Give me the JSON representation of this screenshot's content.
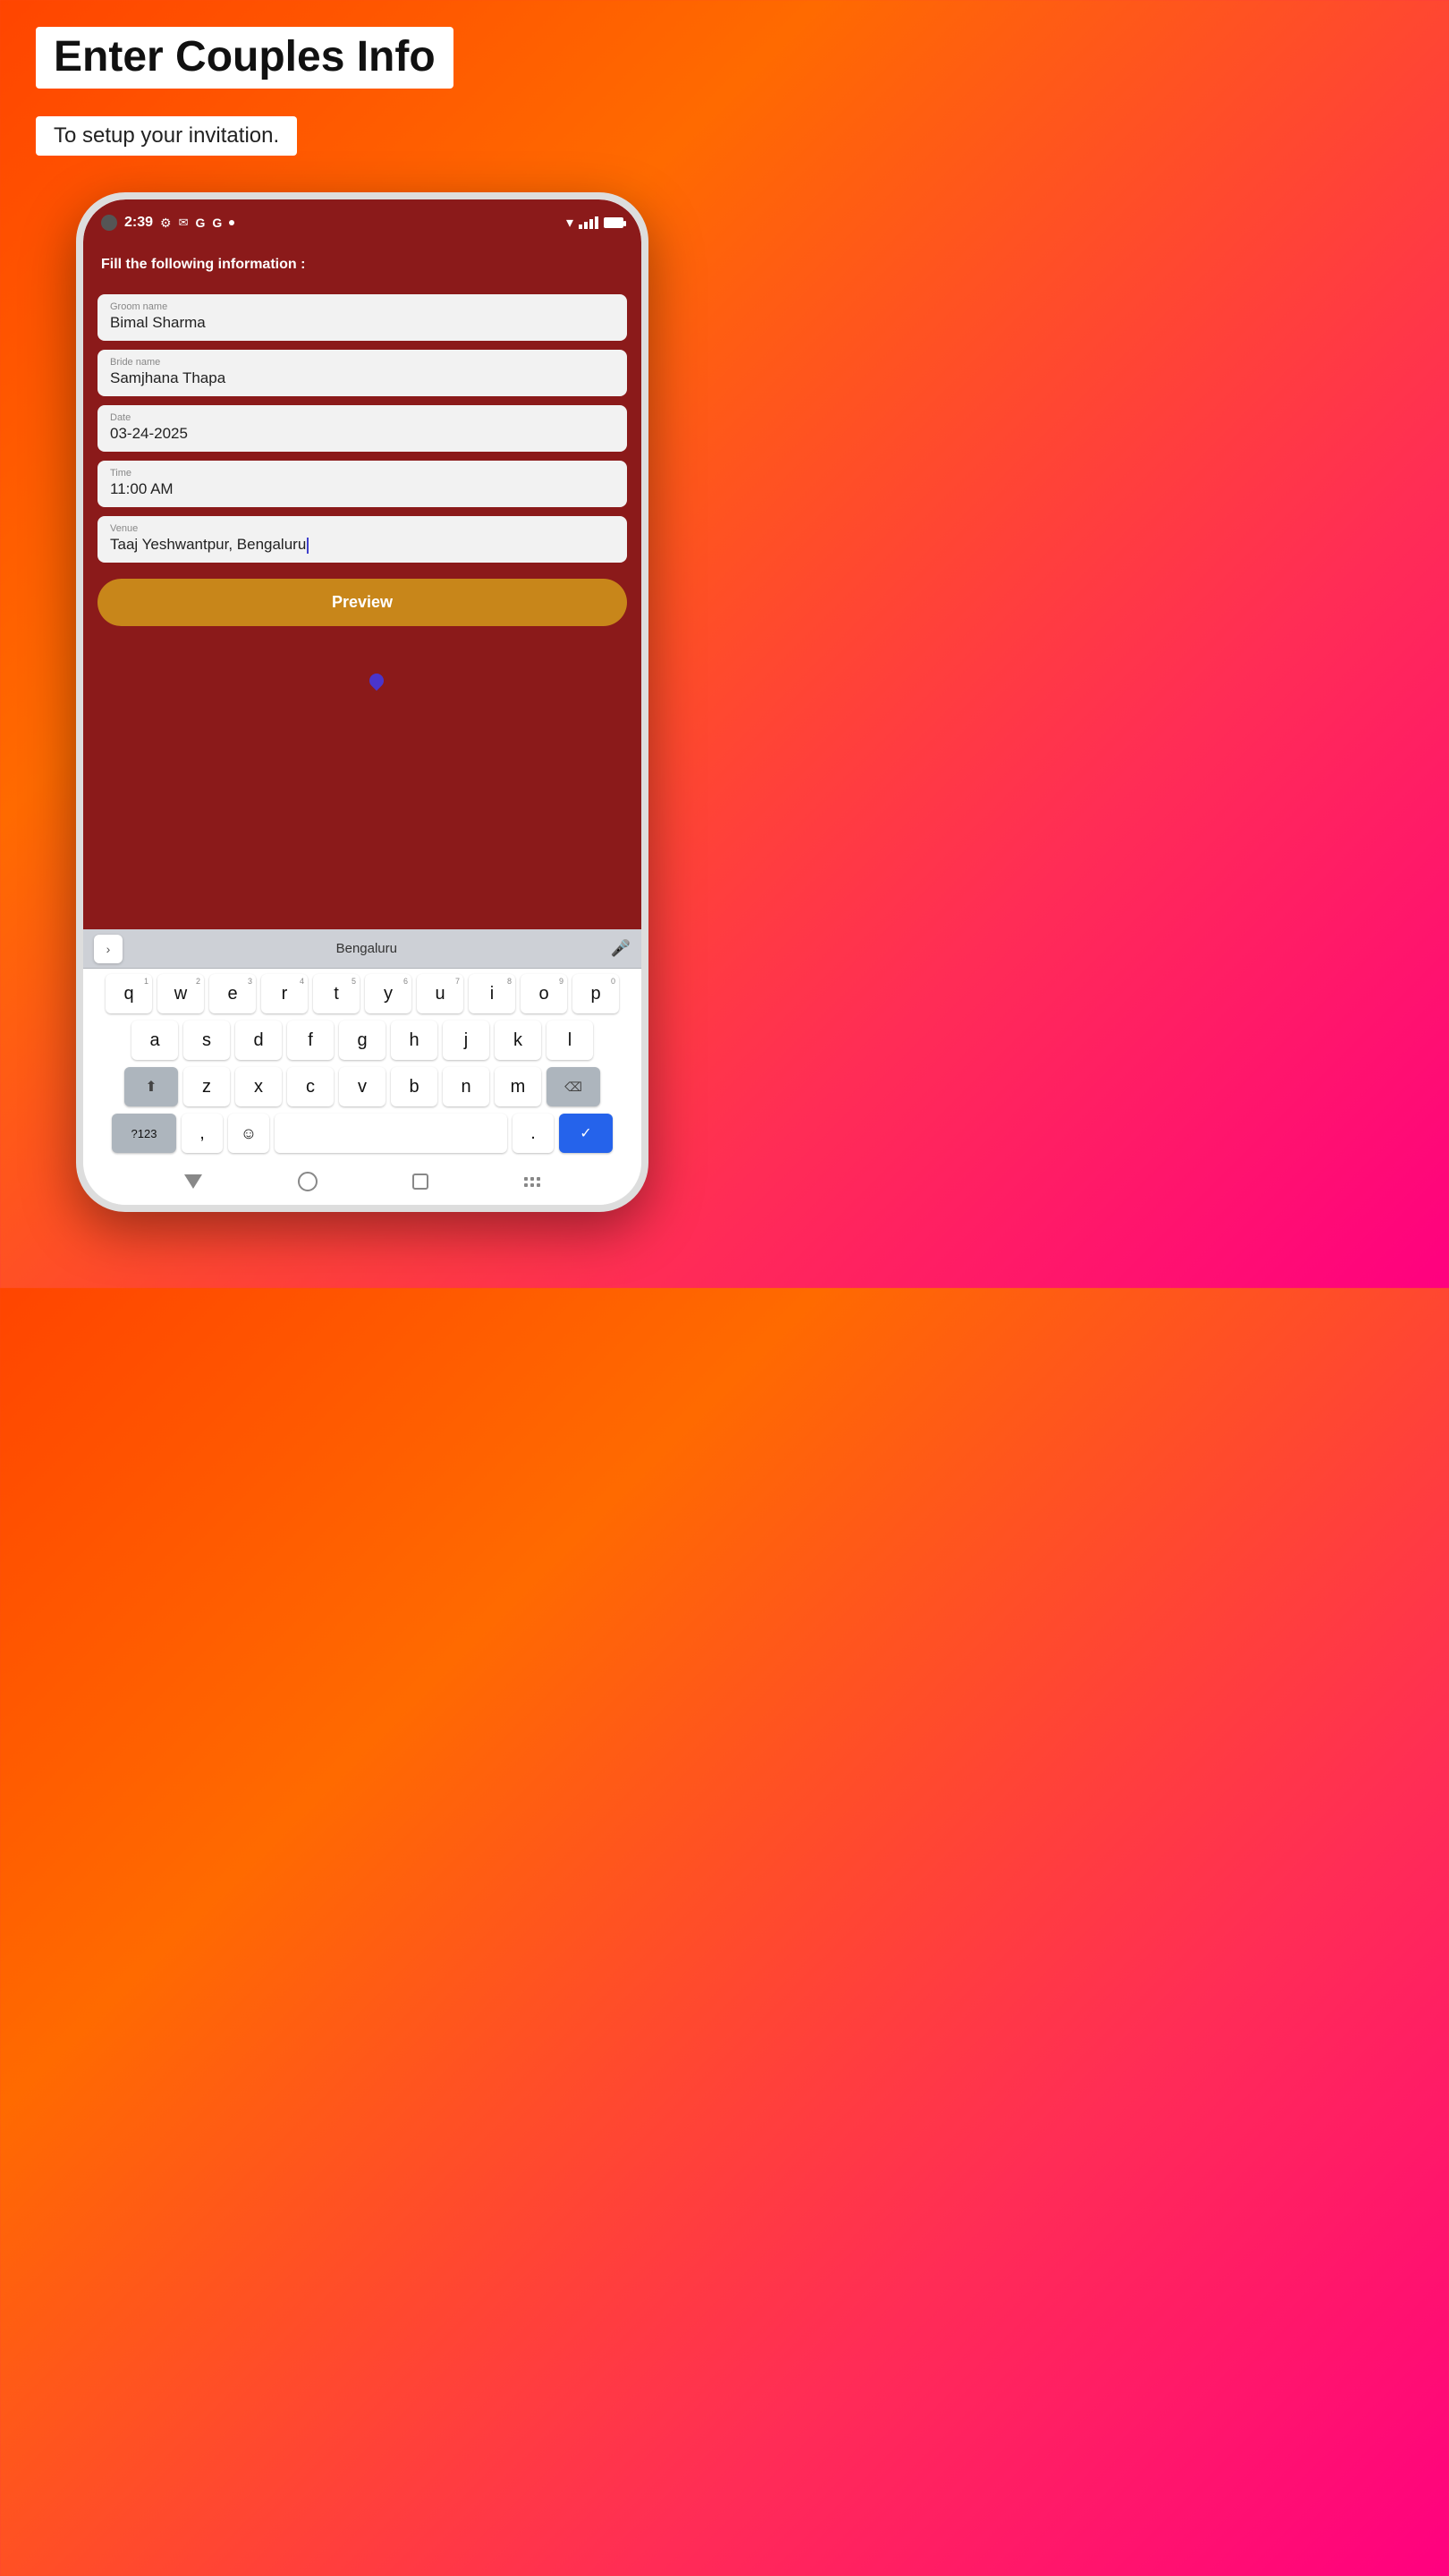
{
  "header": {
    "title": "Enter Couples Info",
    "subtitle": "To setup your invitation."
  },
  "status_bar": {
    "time": "2:39",
    "icons": [
      "⚙",
      "✉",
      "G",
      "G",
      "•"
    ]
  },
  "app": {
    "header_text": "Fill the following information :",
    "fields": [
      {
        "label": "Groom name",
        "value": "Bimal Sharma"
      },
      {
        "label": "Bride name",
        "value": "Samjhana Thapa"
      },
      {
        "label": "Date",
        "value": "03-24-2025"
      },
      {
        "label": "Time",
        "value": "11:00 AM"
      },
      {
        "label": "Venue",
        "value": "Taaj Yeshwantpur, Bengaluru"
      }
    ],
    "preview_button": "Preview"
  },
  "keyboard": {
    "suggestion": "Bengaluru",
    "rows": [
      [
        "q",
        "w",
        "e",
        "r",
        "t",
        "y",
        "u",
        "i",
        "o",
        "p"
      ],
      [
        "a",
        "s",
        "d",
        "f",
        "g",
        "h",
        "j",
        "k",
        "l"
      ],
      [
        "a_shift",
        "z",
        "x",
        "c",
        "v",
        "b",
        "n",
        "m",
        "backspace"
      ],
      [
        "?123",
        ",",
        "emoji",
        "space",
        ".",
        "check"
      ]
    ],
    "number_hints": [
      "1",
      "2",
      "3",
      "4",
      "5",
      "6",
      "7",
      "8",
      "9",
      "0"
    ]
  },
  "colors": {
    "background_gradient_start": "#ff4500",
    "background_gradient_end": "#ff0080",
    "app_header": "#8b1a1a",
    "form_background": "#8b1a1a",
    "field_background": "#f2f2f2",
    "preview_button": "#c8861a",
    "keyboard_bg": "#d1d5db",
    "key_bg": "#ffffff",
    "key_special_bg": "#adb5bd",
    "key_check_bg": "#2563eb"
  }
}
